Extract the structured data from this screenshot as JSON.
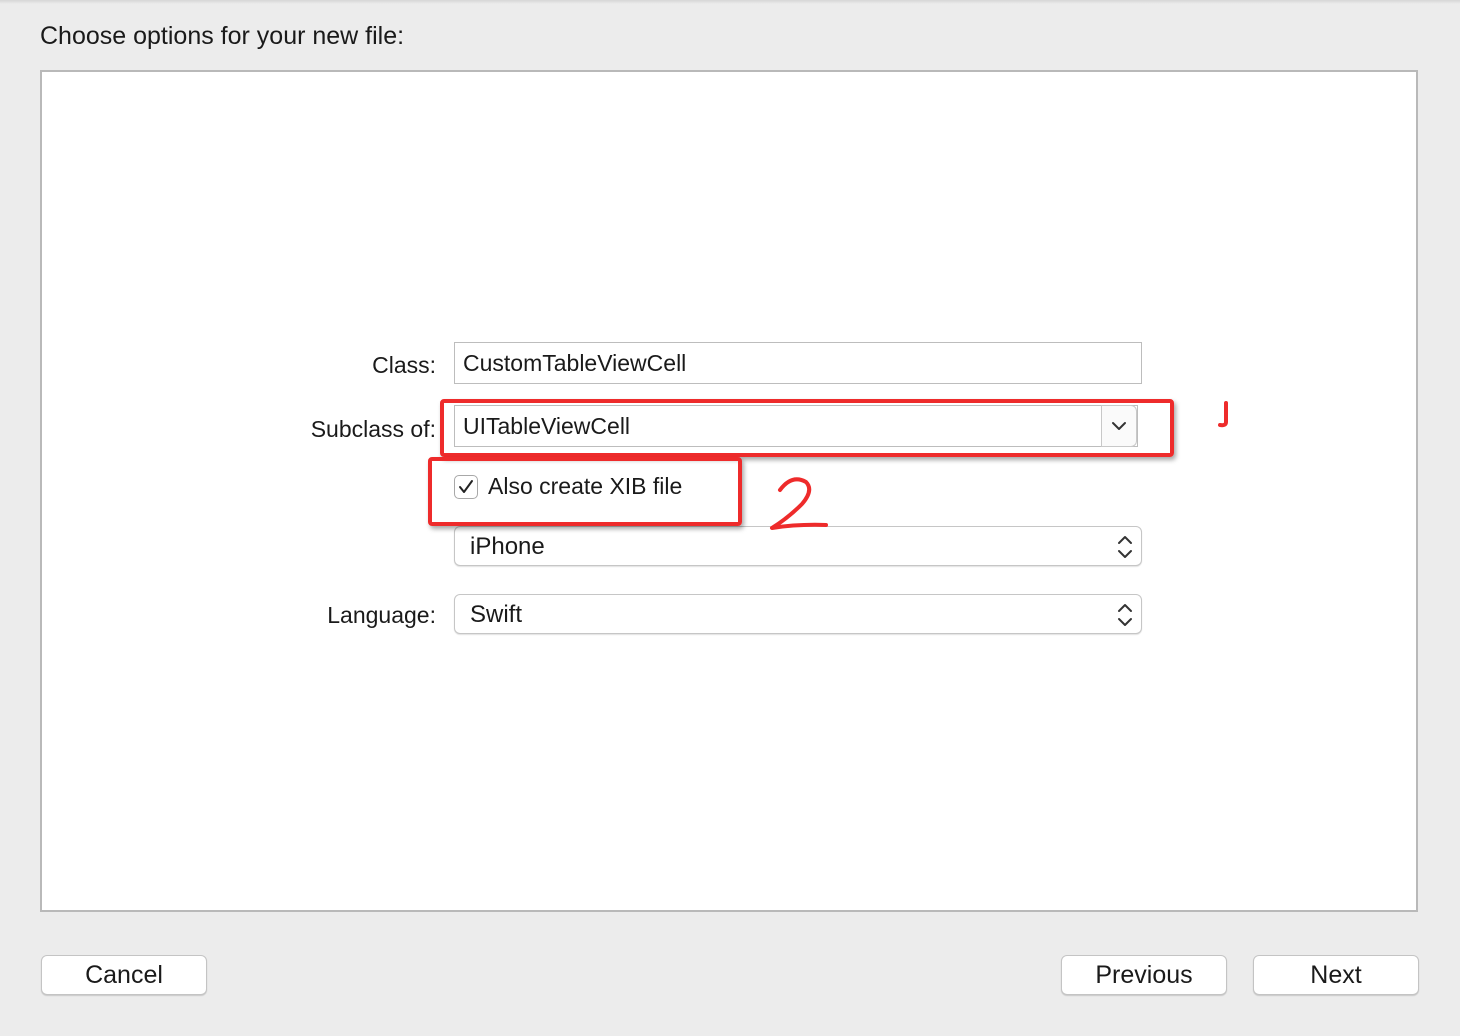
{
  "dialog": {
    "heading": "Choose options for your new file:"
  },
  "form": {
    "class_label": "Class:",
    "class_value": "CustomTableViewCell",
    "subclass_label": "Subclass of:",
    "subclass_value": "UITableViewCell",
    "xib_checkbox_label": "Also create XIB file",
    "xib_checked": true,
    "device_value": "iPhone",
    "language_label": "Language:",
    "language_value": "Swift"
  },
  "annotations": {
    "color": "#ee2b2b",
    "marks": [
      "1",
      "2"
    ]
  },
  "buttons": {
    "cancel": "Cancel",
    "previous": "Previous",
    "next": "Next"
  }
}
